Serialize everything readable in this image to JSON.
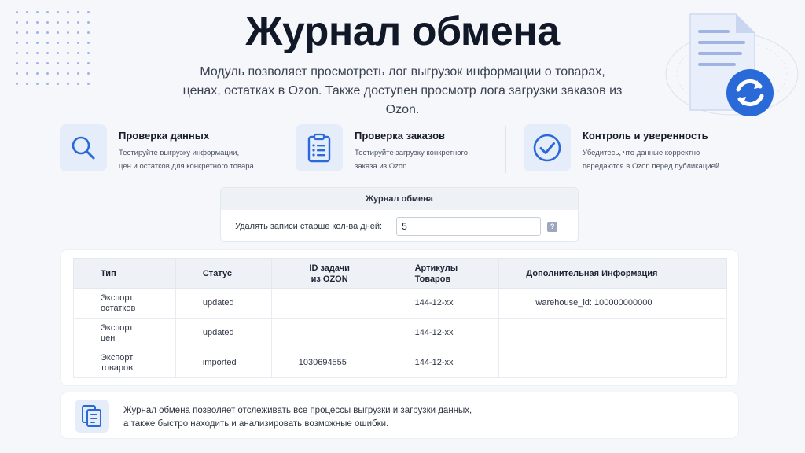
{
  "hero": {
    "title": "Журнал обмена",
    "subtitle_line1": "Модуль позволяет просмотреть лог выгрузок информации о товарах,",
    "subtitle_line2": "ценах, остатках в Ozon. Также доступен просмотр лога загрузки заказов из Ozon."
  },
  "features": [
    {
      "title": "Проверка данных",
      "desc1": "Тестируйте выгрузку информации,",
      "desc2": "цен и остатков для конкретного товара.",
      "icon": "search-icon"
    },
    {
      "title": "Проверка заказов",
      "desc1": "Тестируйте загрузку конкретного",
      "desc2": "заказа из Ozon.",
      "icon": "clipboard-list-icon"
    },
    {
      "title": "Контроль и уверенность",
      "desc1": "Убедитесь, что данные корректно",
      "desc2": "передаются в Ozon перед публикацией.",
      "icon": "check-circle-icon"
    }
  ],
  "settings": {
    "title": "Журнал обмена",
    "delete_label": "Удалять записи старше кол-ва дней:",
    "delete_value": "5",
    "help": "?"
  },
  "table": {
    "headers": {
      "type": "Тип",
      "status": "Статус",
      "task_id_1": "ID задачи",
      "task_id_2": "из OZON",
      "articles_1": "Артикулы",
      "articles_2": "Товаров",
      "info": "Дополнительная Информация"
    },
    "rows": [
      {
        "type1": "Экспорт",
        "type2": "остатков",
        "status": "updated",
        "task_id": "",
        "articles": "144-12-xx",
        "info": "warehouse_id:  100000000000"
      },
      {
        "type1": "Экспорт",
        "type2": "цен",
        "status": "updated",
        "task_id": "",
        "articles": "144-12-xx",
        "info": ""
      },
      {
        "type1": "Экспорт",
        "type2": "товаров",
        "status": "imported",
        "task_id": "1030694555",
        "articles": "144-12-xx",
        "info": ""
      }
    ]
  },
  "note": {
    "line1": "Журнал обмена позволяет отслеживать все процессы выгрузки и загрузки данных,",
    "line2": "а также быстро находить и анализировать возможные ошибки.",
    "icon": "documents-list-icon"
  },
  "colors": {
    "accent": "#2a6ad8",
    "icon_bg": "#e6edfa",
    "background": "#f5f7fb"
  }
}
